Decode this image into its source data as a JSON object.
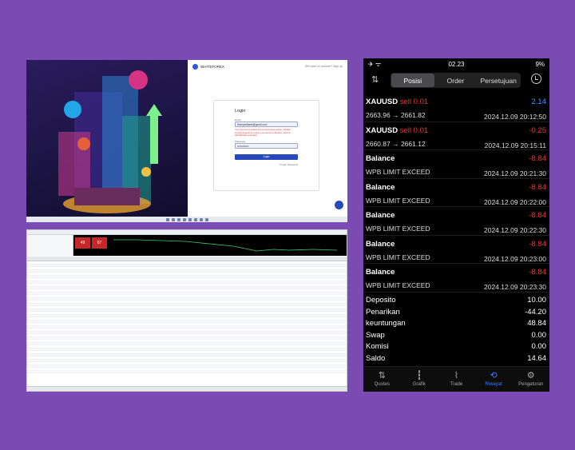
{
  "login_screen": {
    "brand": "WHITEFOREX",
    "top_link": "Still have no account? Sign up",
    "title": "Login",
    "email_label": "Email",
    "email_value": "thomywhitado@gmail.com",
    "error_text": "Your account is locked due to suspicious activity. Please contact support to restore your account. Reason: limit of withdrawals exceeded.",
    "password_label": "Password",
    "password_value": "•••••••••••••",
    "login_button": "Login",
    "forgot_link": "Forgot Password"
  },
  "mt4": {
    "quote_sell": "49",
    "quote_buy": "67"
  },
  "phone": {
    "time": "02.23",
    "battery": "9%",
    "tabs": [
      "Posisi",
      "Order",
      "Persetujuan"
    ],
    "active_tab": "Posisi",
    "history": [
      {
        "title": "XAUUSD",
        "side": "sell 0.01",
        "sub": "2663.96 → 2661.82",
        "value": "2.14",
        "time": "2024.12.09 20:12:50",
        "sign": "pos"
      },
      {
        "title": "XAUUSD",
        "side": "sell 0.01",
        "sub": "2660.87 → 2661.12",
        "value": "-0.25",
        "time": "2024.12.09 20:15:11",
        "sign": "neg"
      },
      {
        "title": "Balance",
        "side": "",
        "sub": "WPB LIMIT EXCEED",
        "value": "-8.84",
        "time": "2024.12.09 20:21:30",
        "sign": "neg"
      },
      {
        "title": "Balance",
        "side": "",
        "sub": "WPB LIMIT EXCEED",
        "value": "-8.84",
        "time": "2024.12.09 20:22:00",
        "sign": "neg"
      },
      {
        "title": "Balance",
        "side": "",
        "sub": "WPB LIMIT EXCEED",
        "value": "-8.84",
        "time": "2024.12.09 20:22:30",
        "sign": "neg"
      },
      {
        "title": "Balance",
        "side": "",
        "sub": "WPB LIMIT EXCEED",
        "value": "-8.84",
        "time": "2024.12.09 20:23:00",
        "sign": "neg"
      },
      {
        "title": "Balance",
        "side": "",
        "sub": "WPB LIMIT EXCEED",
        "value": "-8.84",
        "time": "2024.12.09 20:23:30",
        "sign": "neg"
      }
    ],
    "summary": [
      {
        "label": "Deposito",
        "value": "10.00"
      },
      {
        "label": "Penarikan",
        "value": "-44.20"
      },
      {
        "label": "keuntungan",
        "value": "48.84"
      },
      {
        "label": "Swap",
        "value": "0.00"
      },
      {
        "label": "Komisi",
        "value": "0.00"
      },
      {
        "label": "Saldo",
        "value": "14.64"
      }
    ],
    "bottom_tabs": [
      {
        "label": "Quotes",
        "icon": "arrows-updown-icon"
      },
      {
        "label": "Grafik",
        "icon": "candles-icon"
      },
      {
        "label": "Trade",
        "icon": "chart-line-icon"
      },
      {
        "label": "Riwayat",
        "icon": "history-icon"
      },
      {
        "label": "Pengaturan",
        "icon": "gear-icon"
      }
    ],
    "active_bottom_tab": "Riwayat",
    "colors": {
      "negative": "#e53935",
      "positive": "#4c8dff",
      "active_tab": "#3d7bff"
    }
  }
}
